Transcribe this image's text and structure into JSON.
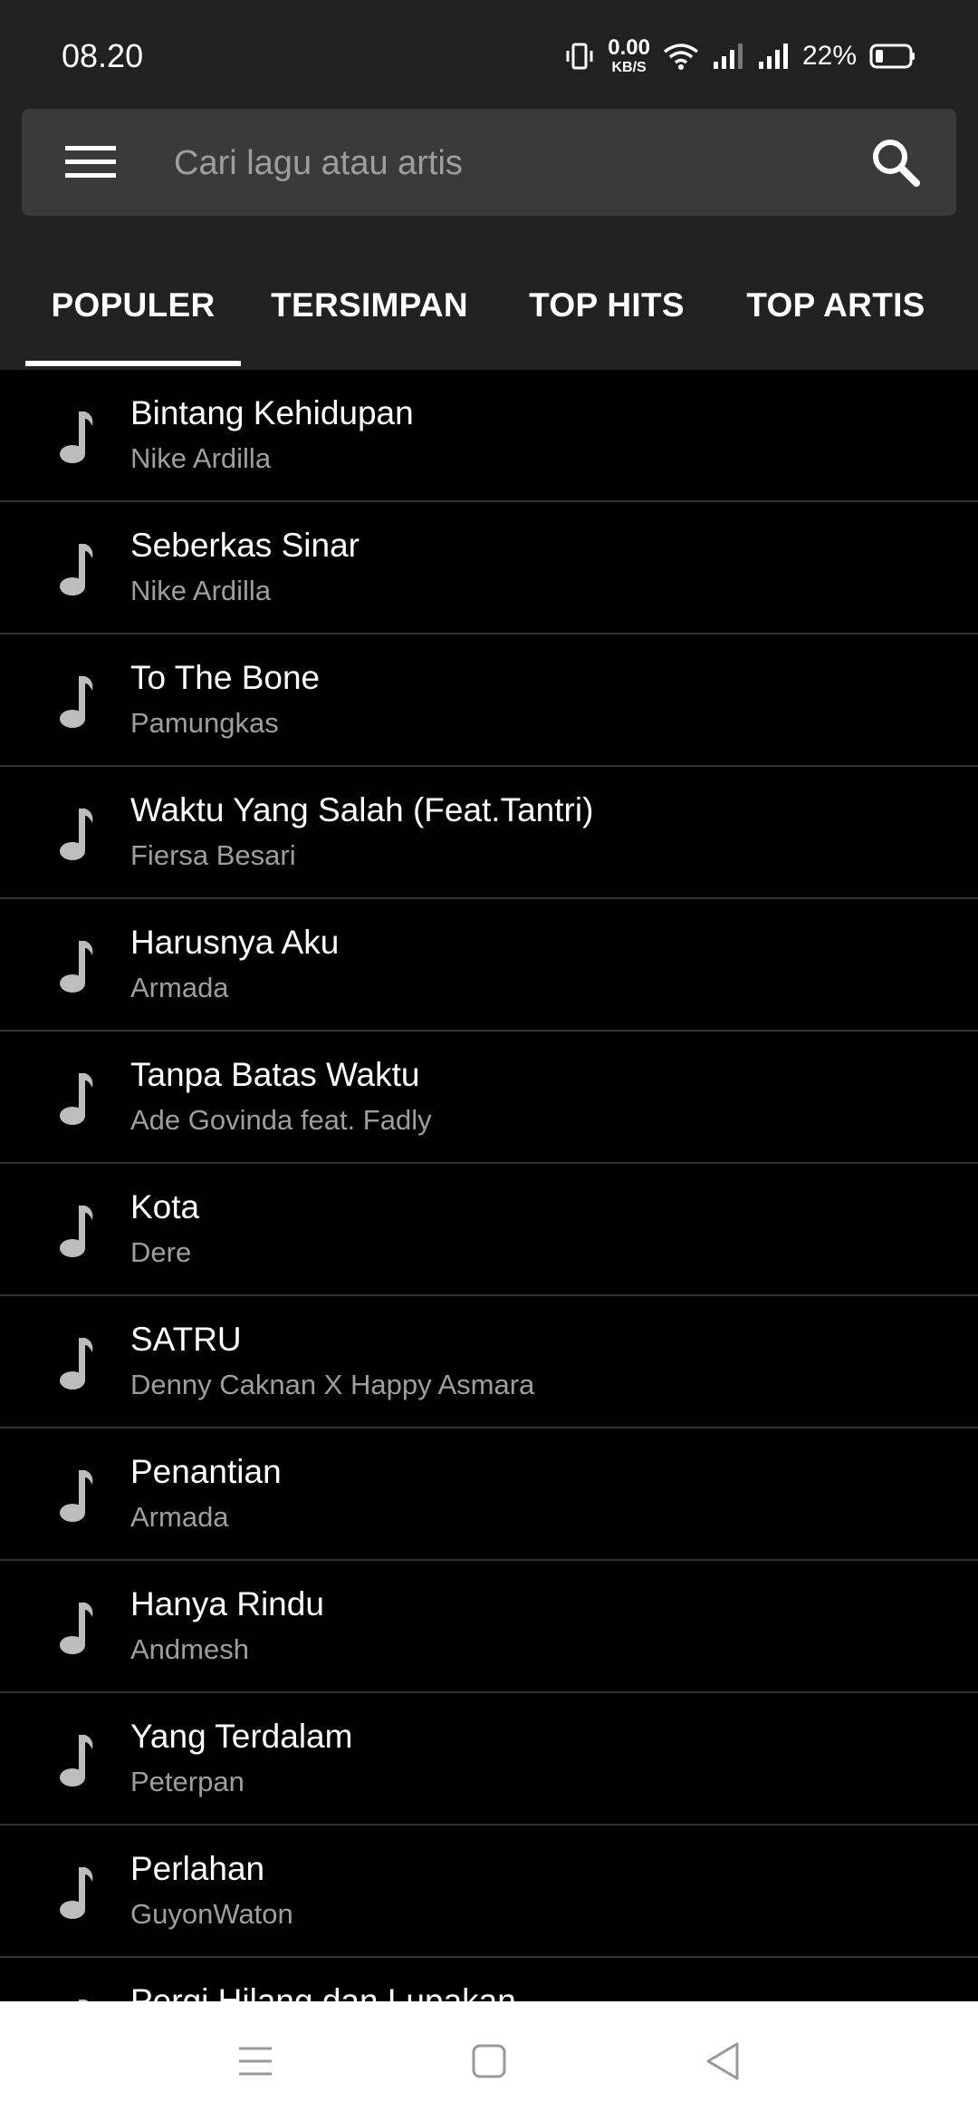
{
  "status_bar": {
    "time": "08.20",
    "net_speed_value": "0.00",
    "net_speed_unit": "KB/S",
    "battery_percent": "22%"
  },
  "search": {
    "placeholder": "Cari lagu atau artis"
  },
  "tabs": [
    {
      "label": "POPULER",
      "active": true
    },
    {
      "label": "TERSIMPAN",
      "active": false
    },
    {
      "label": "TOP HITS",
      "active": false
    },
    {
      "label": "TOP ARTIS",
      "active": false
    }
  ],
  "songs": [
    {
      "title": "Bintang Kehidupan",
      "artist": "Nike Ardilla"
    },
    {
      "title": "Seberkas Sinar",
      "artist": "Nike Ardilla"
    },
    {
      "title": "To The Bone",
      "artist": "Pamungkas"
    },
    {
      "title": "Waktu Yang Salah (Feat.Tantri)",
      "artist": "Fiersa Besari"
    },
    {
      "title": "Harusnya Aku",
      "artist": "Armada"
    },
    {
      "title": "Tanpa Batas Waktu",
      "artist": "Ade Govinda feat. Fadly"
    },
    {
      "title": "Kota",
      "artist": "Dere"
    },
    {
      "title": "SATRU",
      "artist": "Denny Caknan X Happy Asmara"
    },
    {
      "title": "Penantian",
      "artist": "Armada"
    },
    {
      "title": "Hanya Rindu",
      "artist": "Andmesh"
    },
    {
      "title": "Yang Terdalam",
      "artist": "Peterpan"
    },
    {
      "title": "Perlahan",
      "artist": "GuyonWaton"
    },
    {
      "title": "Pergi Hilang dan Lupakan",
      "artist": ""
    }
  ],
  "colors": {
    "app_bar": "#212121",
    "search_box": "#3a3a3a",
    "list_background": "#000000",
    "secondary_text": "#9e9e9e",
    "divider": "#333333",
    "note_icon": "#bdbdbd"
  },
  "icons": {
    "menu": "hamburger-icon",
    "search": "search-icon",
    "song": "music-note-icon",
    "nav": [
      "recents-icon",
      "home-icon",
      "back-icon"
    ]
  }
}
